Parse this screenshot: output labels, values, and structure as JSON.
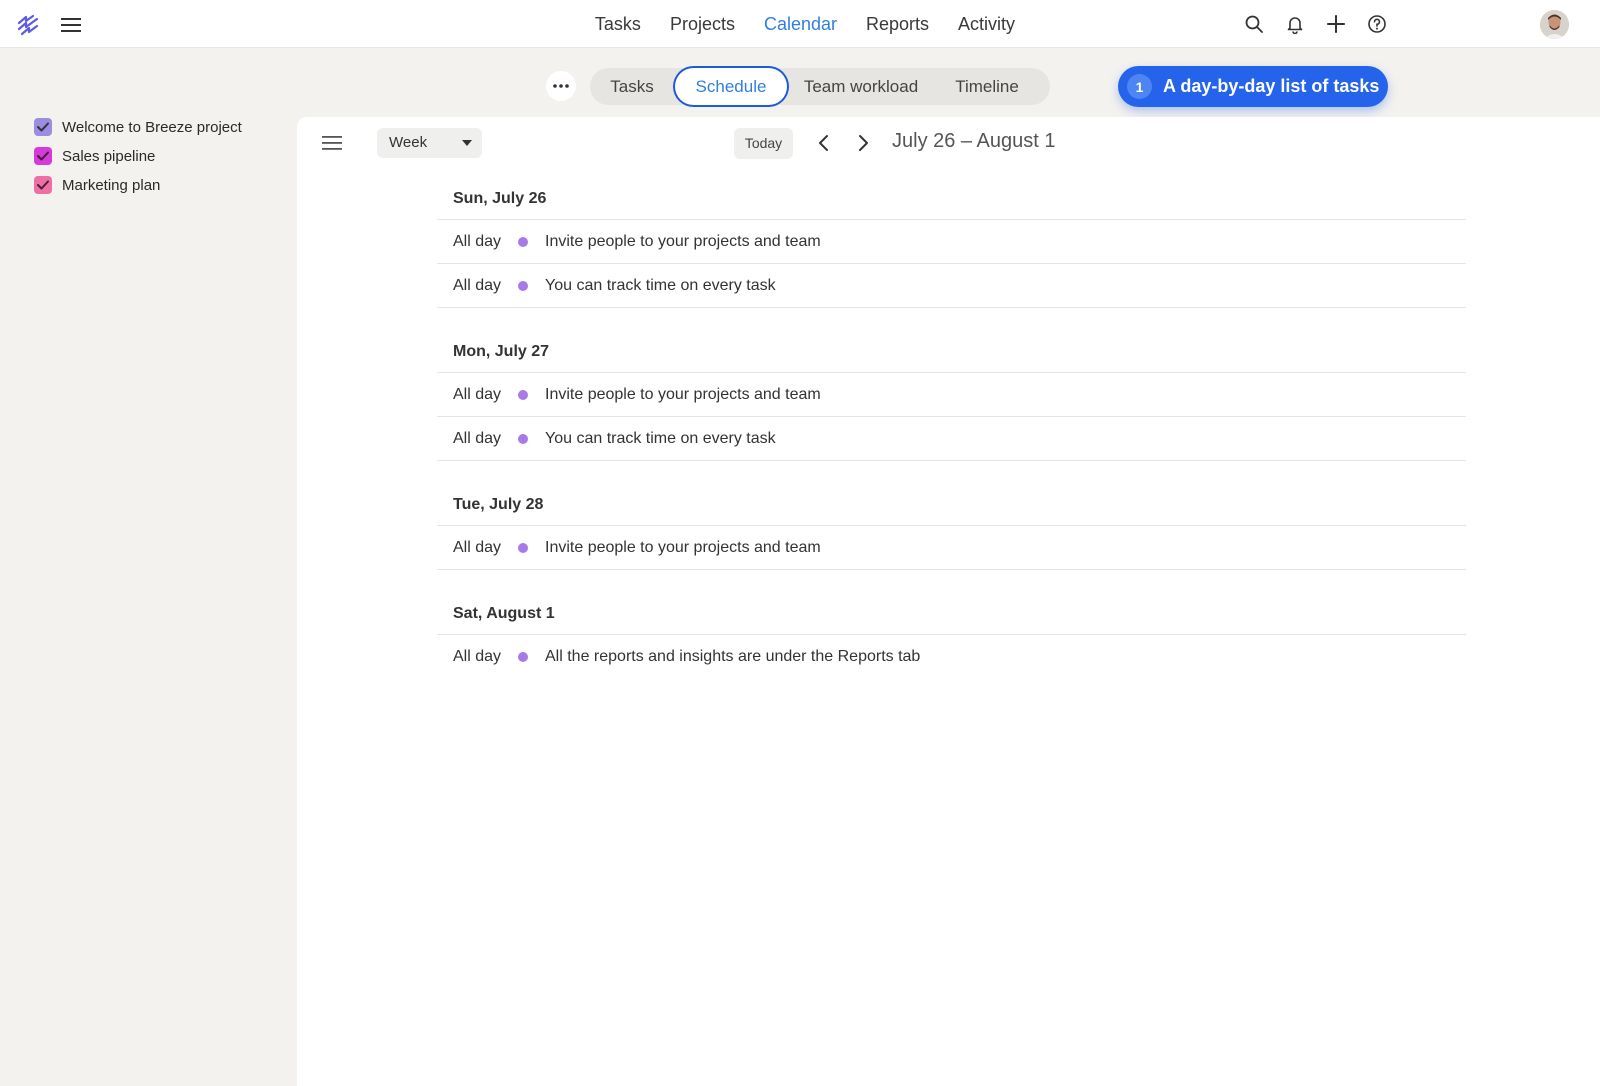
{
  "topnav": {
    "items": [
      {
        "label": "Tasks",
        "active": false
      },
      {
        "label": "Projects",
        "active": false
      },
      {
        "label": "Calendar",
        "active": true
      },
      {
        "label": "Reports",
        "active": false
      },
      {
        "label": "Activity",
        "active": false
      }
    ],
    "icons": [
      "search-icon",
      "bell-icon",
      "plus-icon",
      "help-icon"
    ]
  },
  "sidebar": {
    "projects": [
      {
        "label": "Welcome to Breeze project",
        "color": "#9a8ee0",
        "checked": true
      },
      {
        "label": "Sales pipeline",
        "color": "#d63ad8",
        "checked": true
      },
      {
        "label": "Marketing plan",
        "color": "#ee6fa6",
        "checked": true
      }
    ]
  },
  "viewtabs": {
    "items": [
      {
        "label": "Tasks",
        "active": false
      },
      {
        "label": "Schedule",
        "active": true
      },
      {
        "label": "Team workload",
        "active": false
      },
      {
        "label": "Timeline",
        "active": false
      }
    ]
  },
  "tooltip": {
    "number": "1",
    "text": "A day-by-day list of tasks"
  },
  "toolbar": {
    "period": "Week",
    "today": "Today",
    "range": "July 26 – August 1"
  },
  "schedule": {
    "dot_color": "#a77ae9",
    "days": [
      {
        "date": "Sun, July 26",
        "events": [
          {
            "time": "All day",
            "title": "Invite people to your projects and team"
          },
          {
            "time": "All day",
            "title": "You can track time on every task"
          }
        ]
      },
      {
        "date": "Mon, July 27",
        "events": [
          {
            "time": "All day",
            "title": "Invite people to your projects and team"
          },
          {
            "time": "All day",
            "title": "You can track time on every task"
          }
        ]
      },
      {
        "date": "Tue, July 28",
        "events": [
          {
            "time": "All day",
            "title": "Invite people to your projects and team"
          }
        ]
      },
      {
        "date": "Sat, August 1",
        "events": [
          {
            "time": "All day",
            "title": "All the reports and insights are under the Reports tab"
          }
        ]
      }
    ]
  }
}
